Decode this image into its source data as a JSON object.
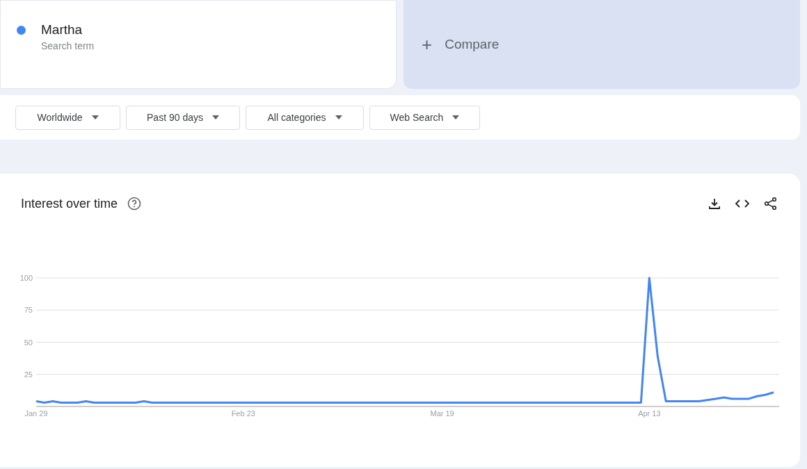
{
  "search_term": {
    "name": "Martha",
    "subtitle": "Search term",
    "color": "#4285f4"
  },
  "compare": {
    "label": "Compare",
    "icon": "+"
  },
  "filters": [
    {
      "label": "Worldwide"
    },
    {
      "label": "Past 90 days"
    },
    {
      "label": "All categories"
    },
    {
      "label": "Web Search"
    }
  ],
  "interest_over_time": {
    "title": "Interest over time",
    "chart_data": {
      "type": "line",
      "grid": true,
      "ylim": [
        0,
        100
      ],
      "yticks": [
        25,
        50,
        75,
        100
      ],
      "categories": [
        "Jan 29",
        null,
        null,
        null,
        null,
        null,
        null,
        null,
        null,
        null,
        null,
        null,
        null,
        null,
        null,
        null,
        null,
        null,
        null,
        null,
        null,
        null,
        null,
        null,
        null,
        "Feb 23",
        null,
        null,
        null,
        null,
        null,
        null,
        null,
        null,
        null,
        null,
        null,
        null,
        null,
        null,
        null,
        null,
        null,
        null,
        null,
        null,
        null,
        null,
        null,
        "Mar 19",
        null,
        null,
        null,
        null,
        null,
        null,
        null,
        null,
        null,
        null,
        null,
        null,
        null,
        null,
        null,
        null,
        null,
        null,
        null,
        null,
        null,
        null,
        null,
        null,
        "Apr 13",
        null,
        null,
        null,
        null,
        null,
        null,
        null,
        null,
        null,
        null,
        null,
        null,
        null,
        null,
        null
      ],
      "series": [
        {
          "color": "#4285f4",
          "values": [
            4,
            3,
            4,
            3,
            3,
            3,
            4,
            3,
            3,
            3,
            3,
            3,
            3,
            4,
            3,
            3,
            3,
            3,
            3,
            3,
            3,
            3,
            3,
            3,
            3,
            3,
            3,
            3,
            3,
            3,
            3,
            3,
            3,
            3,
            3,
            3,
            3,
            3,
            3,
            3,
            3,
            3,
            3,
            3,
            3,
            3,
            3,
            3,
            3,
            3,
            3,
            3,
            3,
            3,
            3,
            3,
            3,
            3,
            3,
            3,
            3,
            3,
            3,
            3,
            3,
            3,
            3,
            3,
            3,
            3,
            3,
            3,
            3,
            3,
            100,
            39,
            4,
            4,
            4,
            4,
            4,
            5,
            6,
            7,
            6,
            6,
            6,
            8,
            9,
            11
          ]
        }
      ]
    }
  }
}
